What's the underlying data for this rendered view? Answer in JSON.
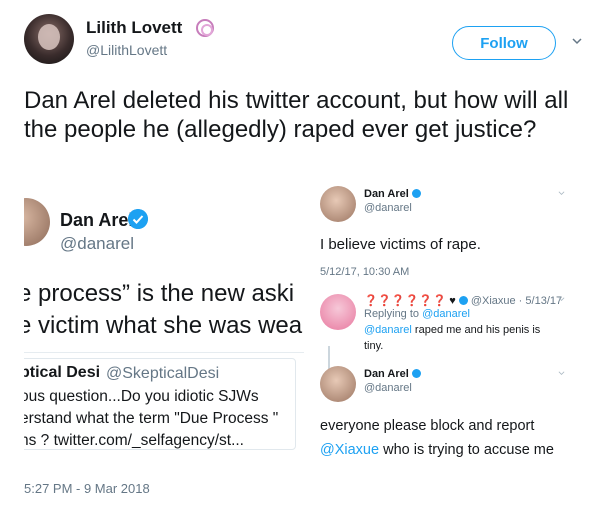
{
  "author": {
    "display_name": "Lilith Lovett",
    "handle": "@LilithLovett",
    "badge_icon": "swirl-icon"
  },
  "follow_button": {
    "label": "Follow"
  },
  "tweet": {
    "text": "Dan Arel deleted his twitter account, but how will all the people he (allegedly) raped ever get justice?",
    "timestamp": "5:27 PM - 9 Mar 2018"
  },
  "left_screenshot": {
    "name": "Dan Arel",
    "handle": "@danarel",
    "line1": "e process” is the new aski",
    "line2": "e victim what she was wea",
    "quote": {
      "name": "ptical Desi",
      "handle": "@SkepticalDesi",
      "line1": "ous question...Do you idiotic SJWs",
      "line2": "erstand what the term \"Due Process \"",
      "line3": "ns ? twitter.com/_selfagency/st..."
    }
  },
  "right_screenshot": {
    "tweet1": {
      "name": "Dan Arel",
      "handle": "@danarel",
      "text": "I believe victims of rape.",
      "date": "5/12/17, 10:30 AM"
    },
    "reply": {
      "name": "❓❓❓❓❓❓ ♥",
      "handle_date": "@Xiaxue · 5/13/17",
      "replying_prefix": "Replying to",
      "replying_to": "@danarel",
      "mention": "@danarel",
      "text_rest": " raped me and his penis is",
      "text_line2": "tiny."
    },
    "tweet2": {
      "name": "Dan Arel",
      "handle": "@danarel",
      "line1": "everyone please block and report",
      "mention": "@Xiaxue",
      "line2_rest": " who is trying to accuse me"
    }
  },
  "colors": {
    "accent": "#1da1f2",
    "text": "#14171a",
    "muted": "#657786"
  }
}
